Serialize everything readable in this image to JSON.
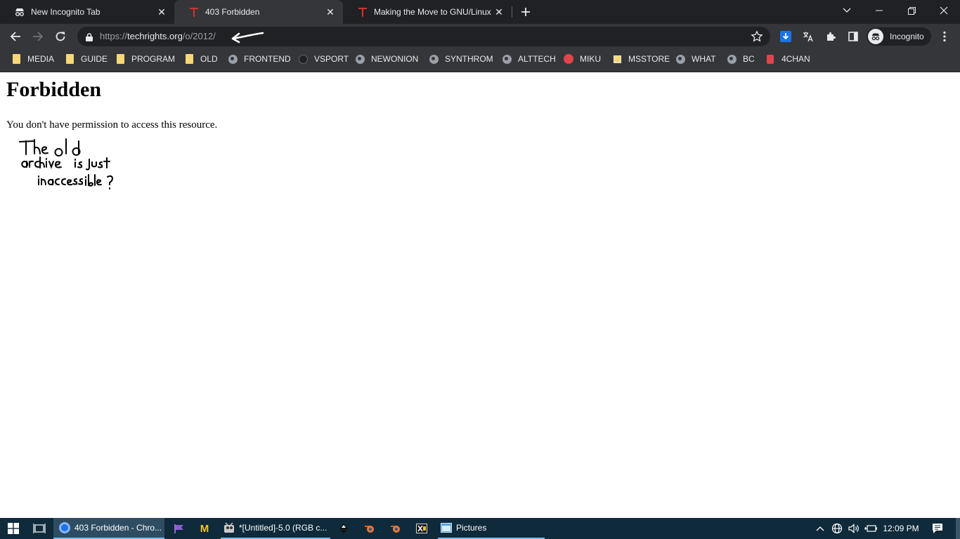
{
  "tabs": [
    {
      "title": "New Incognito Tab",
      "icon": "incognito-icon"
    },
    {
      "title": "403 Forbidden",
      "icon": "techrights-t-icon"
    },
    {
      "title": "Making the Move to GNU/Linux",
      "icon": "techrights-t-icon"
    }
  ],
  "toolbar": {
    "url_scheme": "https://",
    "url_host": "techrights.org",
    "url_path": "/o/2012/",
    "profile_label": "Incognito"
  },
  "bookmarks": [
    {
      "label": "MEDIA",
      "icon": "folder-icon"
    },
    {
      "label": "GUIDE",
      "icon": "folder-icon"
    },
    {
      "label": "PROGRAM",
      "icon": "folder-icon"
    },
    {
      "label": "OLD",
      "icon": "folder-icon"
    },
    {
      "label": "FRONTEND",
      "icon": "globe-icon"
    },
    {
      "label": "VSPORT",
      "icon": "github-icon"
    },
    {
      "label": "NEWONION",
      "icon": "globe-icon"
    },
    {
      "label": "SYNTHROM",
      "icon": "globe-icon"
    },
    {
      "label": "ALTTECH",
      "icon": "globe-icon"
    },
    {
      "label": "MIKU",
      "icon": "miku-icon"
    },
    {
      "label": "MSSTORE",
      "icon": "store-icon"
    },
    {
      "label": "WHAT",
      "icon": "globe-icon"
    },
    {
      "label": "BC",
      "icon": "globe-icon"
    },
    {
      "label": "4CHAN",
      "icon": "4chan-icon"
    }
  ],
  "page": {
    "heading": "Forbidden",
    "message": "You don't have permission to access this resource.",
    "handwritten_note": "The old archive is just inaccessible ?"
  },
  "taskbar": {
    "items": [
      {
        "label": "403 Forbidden - Chro...",
        "icon": "chrome-icon"
      },
      {
        "label": "",
        "icon": "flag-app-icon"
      },
      {
        "label": "",
        "icon": "m-app-icon"
      },
      {
        "label": "*[Untitled]-5.0 (RGB c...",
        "icon": "gimp-icon"
      },
      {
        "label": "",
        "icon": "inkscape-icon"
      },
      {
        "label": "",
        "icon": "blender-icon"
      },
      {
        "label": "",
        "icon": "blender-icon"
      },
      {
        "label": "",
        "icon": "xnview-icon"
      },
      {
        "label": "Pictures",
        "icon": "file-explorer-icon"
      }
    ],
    "clock": "12:09 PM"
  },
  "colors": {
    "tabstrip_bg": "#202124",
    "toolbar_bg": "#35363a",
    "taskbar_bg": "#0f2a3a",
    "accent": "#76b9ed",
    "folder": "#f8d775"
  }
}
